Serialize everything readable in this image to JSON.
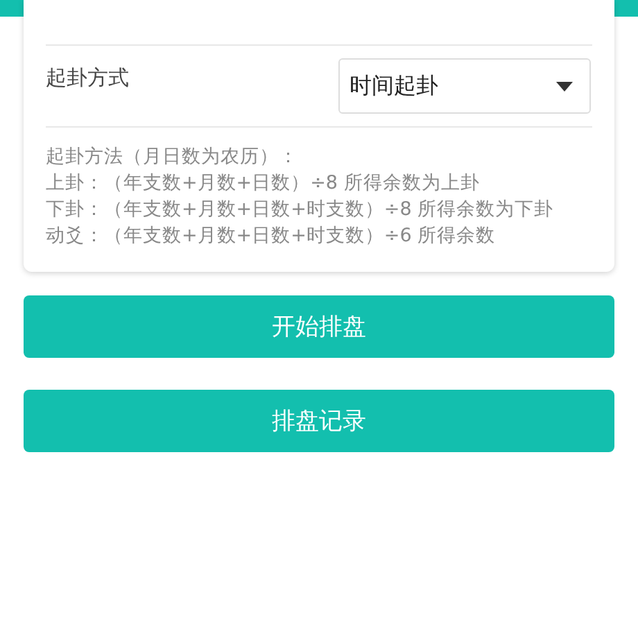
{
  "form": {
    "field": {
      "label": "起卦方式",
      "value": "时间起卦"
    },
    "notes": [
      "起卦方法（月日数为农历）：",
      "上卦：（年支数+月数+日数）÷8 所得余数为上卦",
      "下卦：（年支数+月数+日数+时支数）÷8 所得余数为下卦",
      "动爻：（年支数+月数+日数+时支数）÷6 所得余数"
    ]
  },
  "buttons": [
    "开始排盘",
    "排盘记录"
  ]
}
